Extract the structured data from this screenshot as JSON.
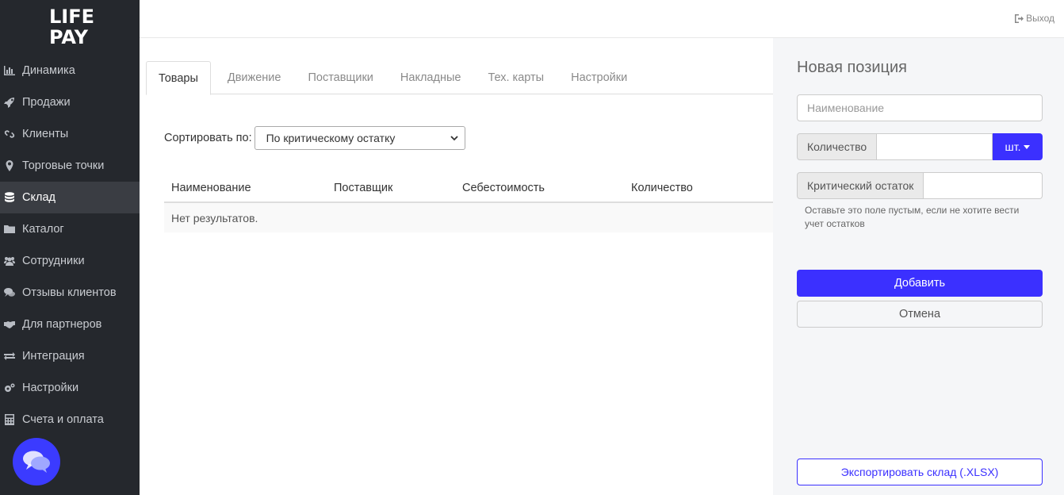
{
  "brand": {
    "line1": "LIFE",
    "line2": "PAY"
  },
  "sidebar": {
    "items": [
      {
        "label": "Динамика",
        "icon": "bar-chart-icon"
      },
      {
        "label": "Продажи",
        "icon": "rocket-icon"
      },
      {
        "label": "Клиенты",
        "icon": "link-icon"
      },
      {
        "label": "Торговые точки",
        "icon": "map-marker-icon"
      },
      {
        "label": "Склад",
        "icon": "database-icon",
        "active": true
      },
      {
        "label": "Каталог",
        "icon": "folder-icon"
      },
      {
        "label": "Сотрудники",
        "icon": "users-icon"
      },
      {
        "label": "Отзывы клиентов",
        "icon": "comments-icon"
      },
      {
        "label": "Для партнеров",
        "icon": "handshake-icon"
      },
      {
        "label": "Интеграция",
        "icon": "exchange-icon"
      },
      {
        "label": "Настройки",
        "icon": "cogs-icon"
      },
      {
        "label": "Счета и оплата",
        "icon": "calculator-icon"
      }
    ]
  },
  "topbar": {
    "logout_label": "Выход"
  },
  "tabs": [
    {
      "label": "Товары",
      "active": true
    },
    {
      "label": "Движение"
    },
    {
      "label": "Поставщики"
    },
    {
      "label": "Накладные"
    },
    {
      "label": "Тех. карты"
    },
    {
      "label": "Настройки"
    }
  ],
  "sort": {
    "label": "Сортировать по:",
    "selected": "По критическому остатку"
  },
  "table": {
    "columns": [
      "Наименование",
      "Поставщик",
      "Себестоимость",
      "Количество"
    ],
    "empty_text": "Нет результатов."
  },
  "panel": {
    "title": "Новая позиция",
    "name_placeholder": "Наименование",
    "quantity_label": "Количество",
    "unit_label": "шт.",
    "critical_label": "Критический остаток",
    "hint": "Оставьте это поле пустым, если не хотите вести учет остатков",
    "add_label": "Добавить",
    "cancel_label": "Отмена",
    "export_label": "Экспортировать склад (.XLSX)"
  },
  "colors": {
    "accent": "#3b30ff",
    "sidebar_bg": "#25282d",
    "panel_bg": "#f5f6f8"
  }
}
